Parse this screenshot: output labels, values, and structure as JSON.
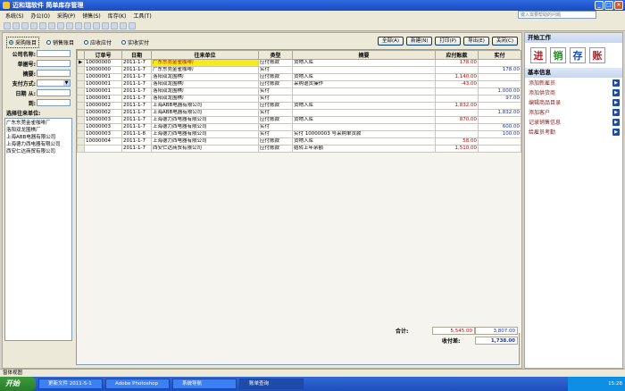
{
  "window": {
    "title": "迈和瑞软件  简单库存管理"
  },
  "menu": [
    "系统(S)",
    "办公(O)",
    "采购(P)",
    "销售(S)",
    "库存(K)",
    "工具(T)"
  ],
  "search_placeholder": "键入需要帮助的问题",
  "radios": [
    {
      "label": "采购账目",
      "selected": true
    },
    {
      "label": "销售账目",
      "selected": false
    },
    {
      "label": "应收应付",
      "selected": false
    },
    {
      "label": "实收实付",
      "selected": false
    }
  ],
  "buttons": {
    "all": "全部(A)",
    "new": "新建(N)",
    "print": "打印(P)",
    "export": "导出(E)",
    "close": "关闭(C)"
  },
  "filters": {
    "company": "公司名称:",
    "doc_no": "单据号:",
    "summary": "摘要:",
    "pay_method": "支付方式:",
    "date_from": "日期   从:",
    "date_to": "到:",
    "list_label": "选择往来单位:"
  },
  "partners": [
    "广东东莞金雀咖啡厂",
    "洛阳双龙围棋厂",
    "上海ABB电器有限公司",
    "上海德力西电器有限公司",
    "西安仁达商贸有限公司"
  ],
  "table": {
    "columns": [
      "订单号",
      "日期",
      "往来单位",
      "类型",
      "摘要",
      "应付账款",
      "实付"
    ],
    "rows": [
      [
        "10000000",
        "2011-1-7",
        "广东东莞金雀咖啡厂",
        "应付账款",
        "货物入库",
        "178.00",
        ""
      ],
      [
        "10000000",
        "2011-1-7",
        "广东东莞金雀咖啡厂",
        "实付",
        "",
        "",
        "178.00"
      ],
      [
        "10000001",
        "2011-1-7",
        "洛阳双龙围棋厂",
        "应付账款",
        "货物入库",
        "1,140.00",
        ""
      ],
      [
        "10000001",
        "2011-1-7",
        "洛阳双龙围棋厂",
        "应付账款",
        "采购退货操作",
        "-43.00",
        ""
      ],
      [
        "10000001",
        "2011-1-7",
        "洛阳双龙围棋厂",
        "实付",
        "",
        "",
        "1,000.00"
      ],
      [
        "10000001",
        "2011-1-7",
        "洛阳双龙围棋厂",
        "实付",
        "",
        "",
        "97.00"
      ],
      [
        "10000002",
        "2011-1-7",
        "上海ABB电器有限公司",
        "应付账款",
        "货物入库",
        "1,832.00",
        ""
      ],
      [
        "10000002",
        "2011-1-7",
        "上海ABB电器有限公司",
        "实付",
        "",
        "",
        "1,832.00"
      ],
      [
        "10000003",
        "2011-1-7",
        "上海德力西电器有限公司",
        "应付账款",
        "货物入库",
        "870.00",
        ""
      ],
      [
        "10000003",
        "2011-1-7",
        "上海德力西电器有限公司",
        "实付",
        "",
        "",
        "600.00"
      ],
      [
        "10000003",
        "2011-1-8",
        "上海德力西电器有限公司",
        "实付",
        "实付 10000003 号采购单货款",
        "",
        "100.00"
      ],
      [
        "10000004",
        "2011-1-7",
        "上海德力西电器有限公司",
        "应付账款",
        "货物入库",
        "58.00",
        ""
      ],
      [
        "",
        "2011-1-7",
        "西安仁达商贸有限公司",
        "应付账款",
        "结转上年余额",
        "1,510.00",
        ""
      ]
    ]
  },
  "totals": {
    "label": "合计:",
    "payable": "5,545.00",
    "paid": "3,807.00",
    "diff_label": "收付差:",
    "diff": "1,738.00"
  },
  "right_panel": {
    "start_title": "开始工作",
    "big_buttons": [
      "进",
      "销",
      "存",
      "账"
    ],
    "big_colors": [
      "#c4171d",
      "#2a8a2a",
      "#1a4fb8",
      "#c4171d"
    ],
    "info_title": "基本信息",
    "links": [
      "添加新雇员",
      "添加供货商",
      "编辑商品目录",
      "添加客户",
      "记录销售信息",
      "给雇员考勤"
    ]
  },
  "statusbar": "窗体视图",
  "taskbar": {
    "start": "开始",
    "tasks": [
      "更新文件 2011-5-1",
      "Adobe Photoshop",
      "系统导航",
      "账单查询"
    ],
    "clock": "15:28"
  }
}
